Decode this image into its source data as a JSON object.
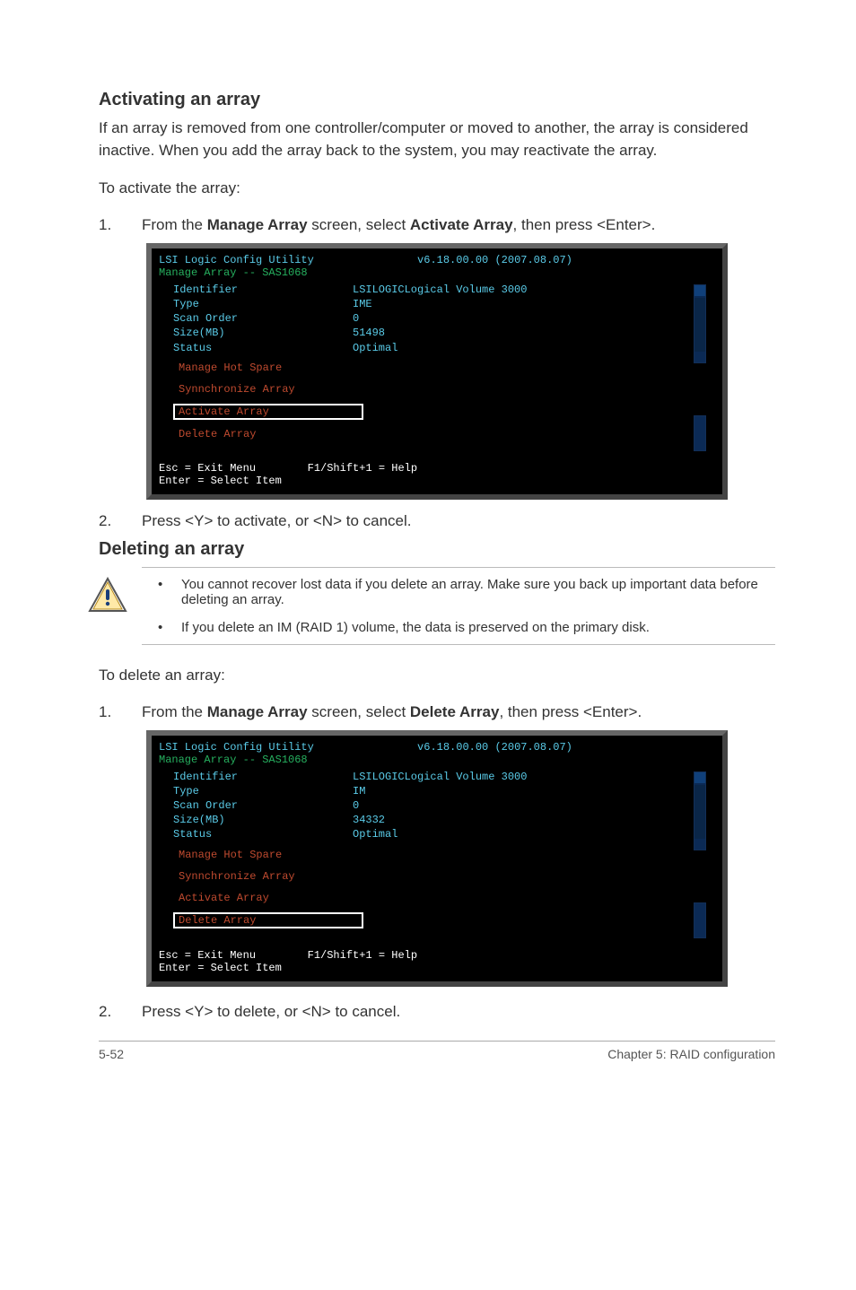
{
  "section1": {
    "title": "Activating an array",
    "para": "If an array is removed from one controller/computer or moved to another, the array is considered inactive. When you add the array back to the system, you may reactivate the array.",
    "lead": "To activate the array:",
    "step1_num": "1.",
    "step1_prefix": "From the ",
    "step1_b1": "Manage Array",
    "step1_mid": " screen, select ",
    "step1_b2": "Activate Array",
    "step1_suffix": ", then press <Enter>.",
    "step2_num": "2.",
    "step2_txt": "Press <Y> to activate, or <N> to cancel."
  },
  "section2": {
    "title": "Deleting an array",
    "warn1": "You cannot recover lost data if you delete an array. Make sure you back up important data before deleting an array.",
    "warn2": "If you delete an IM (RAID 1) volume, the data is preserved on the primary disk.",
    "lead": "To delete an array:",
    "step1_num": "1.",
    "step1_prefix": "From the ",
    "step1_b1": "Manage Array",
    "step1_mid": " screen, select ",
    "step1_b2": "Delete Array",
    "step1_suffix": ", then press <Enter>.",
    "step2_num": "2.",
    "step2_txt": "Press <Y> to delete, or <N> to cancel."
  },
  "term_common": {
    "head_left": "LSI Logic Config Utility",
    "version": "v6.18.00.00 (2007.08.07)",
    "sub": "Manage Array -- SAS1068",
    "labels": {
      "id": "Identifier",
      "type": "Type",
      "scan": "Scan Order",
      "size": "Size(MB)",
      "status": "Status"
    },
    "opts": {
      "hotspare": "Manage Hot Spare",
      "sync": "Synnchronize Array",
      "activate": "Activate Array",
      "delete": "Delete Array"
    },
    "foot": "Esc = Exit Menu        F1/Shift+1 = Help\nEnter = Select Item"
  },
  "term1_vals": {
    "id": "LSILOGICLogical Volume  3000",
    "type": "IME",
    "scan": "0",
    "size": "51498",
    "status": "Optimal"
  },
  "term2_vals": {
    "id": "LSILOGICLogical Volume  3000",
    "type": "IM",
    "scan": "0",
    "size": "34332",
    "status": "Optimal"
  },
  "footer": {
    "left": "5-52",
    "right": "Chapter 5: RAID configuration"
  }
}
